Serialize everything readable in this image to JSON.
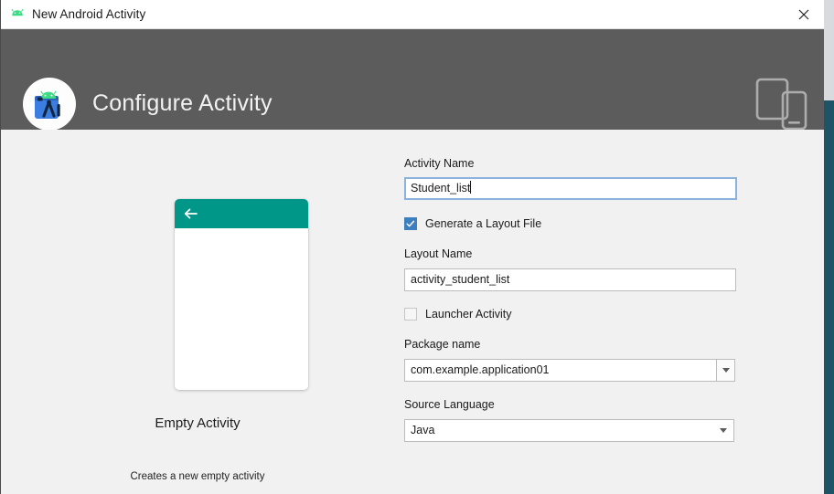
{
  "window": {
    "title": "New Android Activity",
    "app_icon": "android-robot-icon",
    "close_icon": "close-icon"
  },
  "header": {
    "title": "Configure Activity",
    "logo_icon": "android-studio-logo-icon",
    "device_icon": "tablet-and-phone-icon"
  },
  "preview": {
    "back_arrow_icon": "back-arrow-icon",
    "app_bar_color": "#009688",
    "template_name": "Empty Activity",
    "template_description": "Creates a new empty activity"
  },
  "form": {
    "activity_name": {
      "label": "Activity Name",
      "value": "Student_list",
      "focused": true
    },
    "generate_layout_file": {
      "label": "Generate a Layout File",
      "checked": true
    },
    "layout_name": {
      "label": "Layout Name",
      "value": "activity_student_list"
    },
    "launcher_activity": {
      "label": "Launcher Activity",
      "checked": false
    },
    "package_name": {
      "label": "Package name",
      "value": "com.example.application01",
      "dropdown_icon": "chevron-down-icon"
    },
    "source_language": {
      "label": "Source Language",
      "value": "Java",
      "dropdown_icon": "chevron-down-icon"
    }
  },
  "colors": {
    "header_band": "#5c5c5c",
    "accent_checkbox": "#3d7ebf",
    "focus_border": "#8ab2dd",
    "preview_appbar": "#009688",
    "background_app_strip": "#1d5567"
  }
}
